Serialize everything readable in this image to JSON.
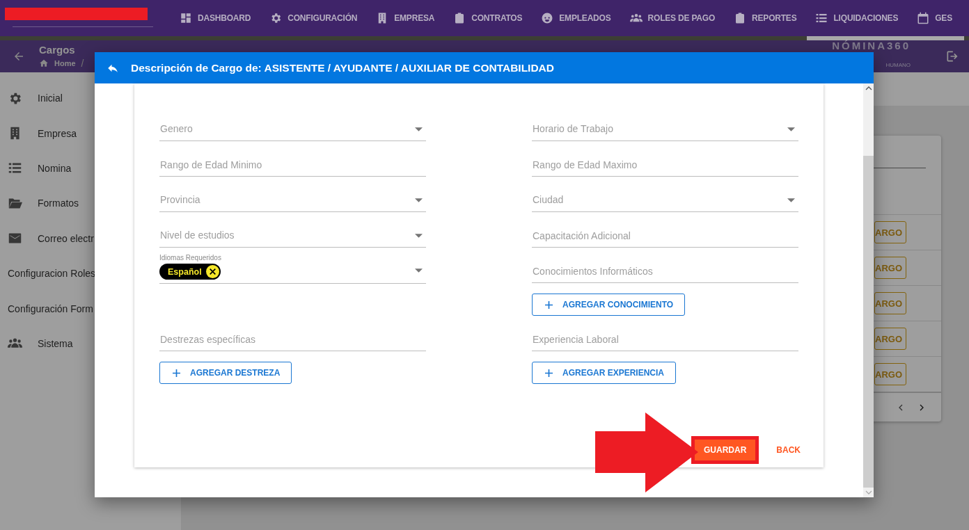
{
  "top_nav": {
    "items": [
      {
        "label": "DASHBOARD"
      },
      {
        "label": "CONFIGURACIÓN"
      },
      {
        "label": "EMPRESA"
      },
      {
        "label": "CONTRATOS"
      },
      {
        "label": "EMPLEADOS"
      },
      {
        "label": "ROLES DE PAGO"
      },
      {
        "label": "REPORTES"
      },
      {
        "label": "LIQUIDACIONES"
      },
      {
        "label": "GES"
      }
    ]
  },
  "page_header": {
    "title": "Cargos",
    "breadcrumb": [
      "Home",
      "/"
    ],
    "logo": "NÓMINA360",
    "logo_tagline": "HUMANO"
  },
  "sidebar": {
    "items": [
      {
        "label": "Inicial"
      },
      {
        "label": "Empresa"
      },
      {
        "label": "Nomina"
      },
      {
        "label": "Formatos"
      },
      {
        "label": "Correo electr"
      },
      {
        "label": "Configuracion Roles"
      },
      {
        "label": "Configuración Form"
      },
      {
        "label": "Sistema"
      }
    ]
  },
  "content_card": {
    "row_buttons": [
      "ARGO",
      "ARGO",
      "ARGO",
      "ARGO",
      "ARGO"
    ]
  },
  "dialog": {
    "title": "Descripción de Cargo de: ASISTENTE / AYUDANTE / AUXILIAR DE CONTABILIDAD",
    "rows": [
      {
        "left": {
          "kind": "select",
          "placeholder": "Genero"
        },
        "right": {
          "kind": "select",
          "placeholder": "Horario de Trabajo"
        }
      },
      {
        "left": {
          "kind": "text",
          "placeholder": "Rango de Edad Minimo"
        },
        "right": {
          "kind": "text",
          "placeholder": "Rango de Edad Maximo"
        }
      },
      {
        "left": {
          "kind": "select",
          "placeholder": "Provincia"
        },
        "right": {
          "kind": "select",
          "placeholder": "Ciudad"
        }
      },
      {
        "left": {
          "kind": "select",
          "placeholder": "Nivel de estudios"
        },
        "right": {
          "kind": "text",
          "placeholder": "Capacitación Adicional"
        }
      },
      {
        "left": {
          "kind": "chips",
          "label": "Idiomas Requeridos",
          "chips": [
            "Español"
          ]
        },
        "right": {
          "kind": "text",
          "placeholder": "Conocimientos Informáticos",
          "add_button": "AGREGAR CONOCIMIENTO"
        }
      },
      {
        "left": {
          "kind": "text",
          "placeholder": "Destrezas específicas",
          "add_button": "AGREGAR DESTREZA"
        },
        "right": {
          "kind": "text",
          "placeholder": "Experiencia Laboral",
          "add_button": "AGREGAR EXPERIENCIA"
        }
      }
    ],
    "actions": [
      {
        "label": "GUARDAR",
        "kind": "raised"
      },
      {
        "label": "BACK",
        "kind": "flat"
      }
    ]
  }
}
